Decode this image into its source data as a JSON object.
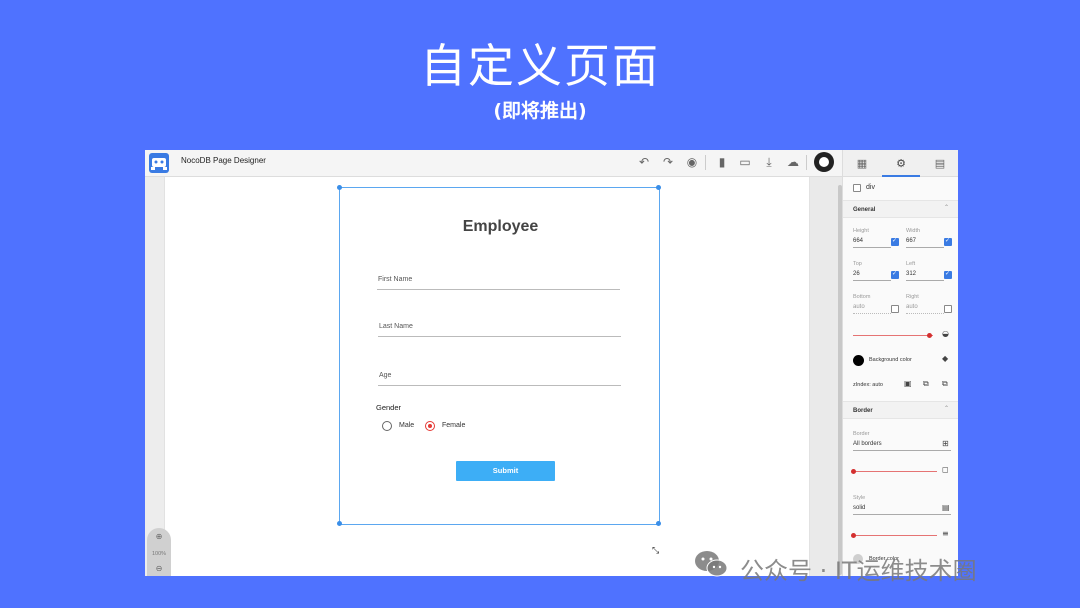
{
  "slide": {
    "title": "自定义页面",
    "subtitle": "(即将推出)"
  },
  "app": {
    "title": "NocoDB Page Designer",
    "toolbar": [
      "undo-icon",
      "redo-icon",
      "eye-icon",
      "trash-icon",
      "folder-icon",
      "download-icon",
      "cloud-off-icon",
      "github-icon"
    ]
  },
  "form": {
    "title": "Employee",
    "first_name_label": "First Name",
    "last_name_label": "Last Name",
    "age_label": "Age",
    "gender_label": "Gender",
    "options": [
      "Male",
      "Female"
    ],
    "selected_option": "Female",
    "submit_label": "Submit"
  },
  "zoom": {
    "level": "100%"
  },
  "panel": {
    "tabs": [
      "blocks-icon",
      "settings-icon",
      "page-icon"
    ],
    "active_tab": "settings-icon",
    "element_tag": "div",
    "general": {
      "header": "General",
      "height_label": "Height",
      "height_value": "664",
      "width_label": "Width",
      "width_value": "667",
      "top_label": "Top",
      "top_value": "26",
      "left_label": "Left",
      "left_value": "312",
      "bottom_label": "Bottom",
      "bottom_value": "auto",
      "right_label": "Right",
      "right_value": "auto",
      "background_label": "Background color",
      "background_color": "#000000",
      "zindex_label": "zIndex: auto"
    },
    "border": {
      "header": "Border",
      "border_label": "Border",
      "border_value": "All borders",
      "style_label": "Style",
      "style_value": "solid",
      "color_label": "Border color"
    }
  },
  "watermark": {
    "text": "公众号 · IT运维技术圈"
  },
  "colors": {
    "background": "#4F72FF",
    "accent": "#3A7BE3",
    "submit": "#3DAEF6",
    "radio_selected": "#E53935"
  }
}
